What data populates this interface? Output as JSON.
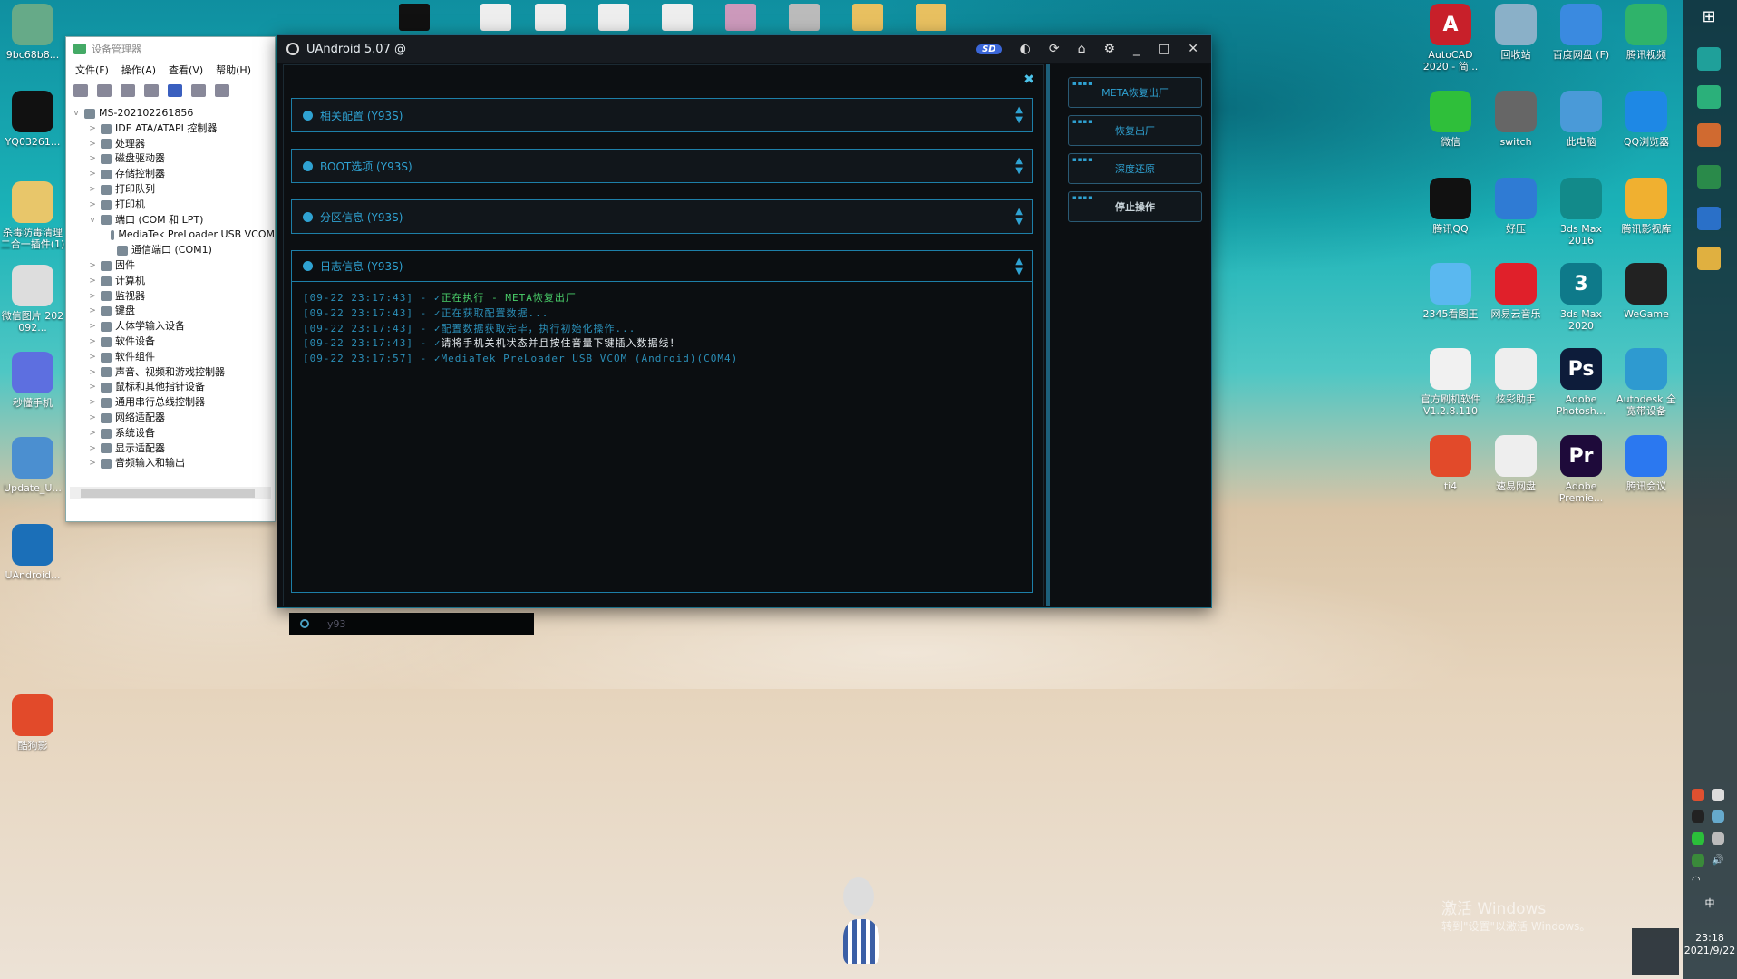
{
  "top_thumbs": [
    "",
    "",
    "",
    "",
    "",
    "",
    "",
    "",
    ""
  ],
  "devmgr": {
    "title": "设备管理器",
    "menu": [
      "文件(F)",
      "操作(A)",
      "查看(V)",
      "帮助(H)"
    ],
    "tree": [
      {
        "label": "MS-202102261856",
        "level": 0,
        "chev": "v"
      },
      {
        "label": "IDE ATA/ATAPI 控制器",
        "level": 1,
        "chev": ">"
      },
      {
        "label": "处理器",
        "level": 1,
        "chev": ">"
      },
      {
        "label": "磁盘驱动器",
        "level": 1,
        "chev": ">"
      },
      {
        "label": "存储控制器",
        "level": 1,
        "chev": ">"
      },
      {
        "label": "打印队列",
        "level": 1,
        "chev": ">"
      },
      {
        "label": "打印机",
        "level": 1,
        "chev": ">"
      },
      {
        "label": "端口 (COM 和 LPT)",
        "level": 1,
        "chev": "v"
      },
      {
        "label": "MediaTek PreLoader USB VCOM",
        "level": 2,
        "chev": ""
      },
      {
        "label": "通信端口 (COM1)",
        "level": 2,
        "chev": ""
      },
      {
        "label": "固件",
        "level": 1,
        "chev": ">"
      },
      {
        "label": "计算机",
        "level": 1,
        "chev": ">"
      },
      {
        "label": "监视器",
        "level": 1,
        "chev": ">"
      },
      {
        "label": "键盘",
        "level": 1,
        "chev": ">"
      },
      {
        "label": "人体学输入设备",
        "level": 1,
        "chev": ">"
      },
      {
        "label": "软件设备",
        "level": 1,
        "chev": ">"
      },
      {
        "label": "软件组件",
        "level": 1,
        "chev": ">"
      },
      {
        "label": "声音、视频和游戏控制器",
        "level": 1,
        "chev": ">"
      },
      {
        "label": "鼠标和其他指针设备",
        "level": 1,
        "chev": ">"
      },
      {
        "label": "通用串行总线控制器",
        "level": 1,
        "chev": ">"
      },
      {
        "label": "网络适配器",
        "level": 1,
        "chev": ">"
      },
      {
        "label": "系统设备",
        "level": 1,
        "chev": ">"
      },
      {
        "label": "显示适配器",
        "level": 1,
        "chev": ">"
      },
      {
        "label": "音频输入和输出",
        "level": 1,
        "chev": ">"
      }
    ]
  },
  "uandroid": {
    "title": "UAndroid 5.07 @",
    "sd_badge": "SD",
    "close_glyph": "✖",
    "panels": [
      "相关配置 (Y93S)",
      "BOOT选项 (Y93S)",
      "分区信息 (Y93S)"
    ],
    "log_title": "日志信息 (Y93S)",
    "logs": [
      {
        "ts": "[09-22 23:17:43] -",
        "msg": "正在执行 - META恢复出厂",
        "color": "#4ad06a"
      },
      {
        "ts": "[09-22 23:17:43] -",
        "msg": "正在获取配置数据...",
        "color": "#2b8fb8"
      },
      {
        "ts": "[09-22 23:17:43] -",
        "msg": "配置数据获取完毕，执行初始化操作...",
        "color": "#2b8fb8"
      },
      {
        "ts": "[09-22 23:17:43] -",
        "msg": "请将手机关机状态并且按住音量下键插入数据线！",
        "color": "#e8eef2"
      },
      {
        "ts": "[09-22 23:17:57] -",
        "msg": "MediaTek PreLoader USB VCOM (Android)(COM4)",
        "color": "#2b8fb8"
      }
    ],
    "search_value": "y93",
    "side_buttons": [
      "META恢复出厂",
      "恢复出厂",
      "深度还原",
      "停止操作"
    ]
  },
  "desktop_left": [
    {
      "label": "9bc68b8...",
      "color": "#6a8"
    },
    {
      "label": "YQ03261...",
      "color": "#111"
    },
    {
      "label": "杀毒防毒清理 二合一插件(1)",
      "color": "#e8c66a"
    },
    {
      "label": "微信图片 202 092...",
      "color": "#ddd"
    },
    {
      "label": "秒懂手机",
      "color": "#5d6fe0"
    },
    {
      "label": "Update_U...",
      "color": "#4b8fd0"
    },
    {
      "label": "UAndroid...",
      "color": "#1b6fb8"
    },
    {
      "label": "酷狗影",
      "color": "#e24a2a"
    }
  ],
  "desktop_right": [
    {
      "label": "AutoCAD 2020 - 简...",
      "color": "#c8202a",
      "glyph": "A"
    },
    {
      "label": "回收站",
      "color": "#8ab0c8",
      "glyph": ""
    },
    {
      "label": "百度网盘 (F)",
      "color": "#3a8ae0",
      "glyph": ""
    },
    {
      "label": "腾讯视频",
      "color": "#2fb36a",
      "glyph": ""
    },
    {
      "label": "微信",
      "color": "#2fbf3a",
      "glyph": ""
    },
    {
      "label": "switch",
      "color": "#666",
      "glyph": ""
    },
    {
      "label": "此电脑",
      "color": "#4a9ad8",
      "glyph": ""
    },
    {
      "label": "QQ浏览器",
      "color": "#1e88e5",
      "glyph": ""
    },
    {
      "label": "腾讯QQ",
      "color": "#111",
      "glyph": ""
    },
    {
      "label": "好压",
      "color": "#2f7bd4",
      "glyph": ""
    },
    {
      "label": "3ds Max 2016",
      "color": "#128a8a",
      "glyph": ""
    },
    {
      "label": "腾讯影视库",
      "color": "#f0b030",
      "glyph": ""
    },
    {
      "label": "2345看图王",
      "color": "#5ab8f0",
      "glyph": ""
    },
    {
      "label": "网易云音乐",
      "color": "#e0202a",
      "glyph": ""
    },
    {
      "label": "3ds Max 2020",
      "color": "#0e7a8a",
      "glyph": "3"
    },
    {
      "label": "WeGame",
      "color": "#222",
      "glyph": ""
    },
    {
      "label": "官方刷机软件 V1.2.8.110",
      "color": "#f1f1f1",
      "glyph": ""
    },
    {
      "label": "炫彩助手",
      "color": "#eee",
      "glyph": ""
    },
    {
      "label": "Adobe Photosh...",
      "color": "#0d1c3a",
      "glyph": "Ps"
    },
    {
      "label": "Autodesk 全 宽带设备",
      "color": "#2e9ad0",
      "glyph": ""
    },
    {
      "label": "ti4",
      "color": "#e24a2a",
      "glyph": ""
    },
    {
      "label": "速易网盘",
      "color": "#eee",
      "glyph": ""
    },
    {
      "label": "Adobe Premie...",
      "color": "#1e0a3a",
      "glyph": "Pr"
    },
    {
      "label": "腾讯会议",
      "color": "#2b78f0",
      "glyph": ""
    }
  ],
  "watermark": {
    "line1": "激活 Windows",
    "line2": "转到\"设置\"以激活 Windows。"
  },
  "clock": {
    "time": "23:18",
    "date": "2021/9/22"
  },
  "ime": "中"
}
